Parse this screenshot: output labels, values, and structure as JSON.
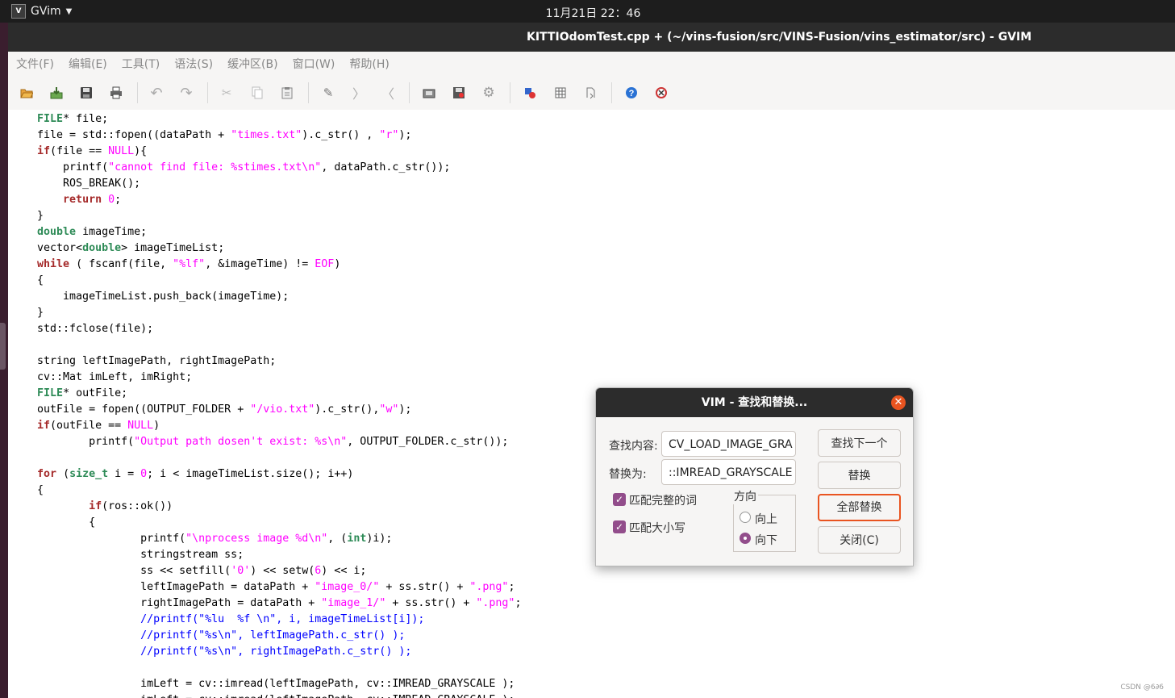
{
  "topbar": {
    "app_name": "GVim",
    "clock": "11月21日  22：46"
  },
  "window": {
    "title": "KITTIOdomTest.cpp + (~/vins-fusion/src/VINS-Fusion/vins_estimator/src) - GVIM"
  },
  "menubar": [
    "文件(F)",
    "编辑(E)",
    "工具(T)",
    "语法(S)",
    "缓冲区(B)",
    "窗口(W)",
    "帮助(H)"
  ],
  "toolbar": [
    {
      "icon": "open-file-icon"
    },
    {
      "icon": "save-download-icon"
    },
    {
      "icon": "save-icon"
    },
    {
      "icon": "print-icon"
    },
    {
      "icon": "undo-icon"
    },
    {
      "icon": "redo-icon"
    },
    {
      "icon": "cut-icon"
    },
    {
      "icon": "copy-icon"
    },
    {
      "icon": "paste-icon"
    },
    {
      "icon": "find-replace-icon"
    },
    {
      "icon": "find-next-icon"
    },
    {
      "icon": "find-prev-icon"
    },
    {
      "icon": "load-session-icon"
    },
    {
      "icon": "save-session-icon"
    },
    {
      "icon": "run-script-icon"
    },
    {
      "icon": "make-icon"
    },
    {
      "icon": "shell-icon"
    },
    {
      "icon": "ctags-icon"
    },
    {
      "icon": "help-icon"
    },
    {
      "icon": "find-help-icon"
    }
  ],
  "editor": {
    "lines": [
      [
        [
          "    ",
          ""
        ],
        [
          "FILE",
          "ty"
        ],
        [
          "* file;",
          ""
        ]
      ],
      [
        [
          "    file = std::fopen((dataPath + ",
          ""
        ],
        [
          "\"times.txt\"",
          "st"
        ],
        [
          ").c_str() , ",
          ""
        ],
        [
          "\"r\"",
          "st"
        ],
        [
          ");",
          ""
        ]
      ],
      [
        [
          "    ",
          ""
        ],
        [
          "if",
          "kw"
        ],
        [
          "(file == ",
          ""
        ],
        [
          "NULL",
          "st"
        ],
        [
          "){",
          ""
        ]
      ],
      [
        [
          "        printf(",
          ""
        ],
        [
          "\"cannot find file: ",
          "st"
        ],
        [
          "%s",
          "st"
        ],
        [
          "times.txt",
          "st"
        ],
        [
          "\\n\"",
          "st"
        ],
        [
          ", dataPath.c_str());",
          ""
        ]
      ],
      [
        [
          "        ROS_BREAK();",
          ""
        ]
      ],
      [
        [
          "        ",
          ""
        ],
        [
          "return",
          "kw"
        ],
        [
          " ",
          ""
        ],
        [
          "0",
          "st"
        ],
        [
          ";",
          ""
        ]
      ],
      [
        [
          "    }",
          ""
        ]
      ],
      [
        [
          "    ",
          ""
        ],
        [
          "double",
          "ty"
        ],
        [
          " imageTime;",
          ""
        ]
      ],
      [
        [
          "    vector<",
          ""
        ],
        [
          "double",
          "ty"
        ],
        [
          "> imageTimeList;",
          ""
        ]
      ],
      [
        [
          "    ",
          ""
        ],
        [
          "while",
          "kw"
        ],
        [
          " ( fscanf(file, ",
          ""
        ],
        [
          "\"%lf\"",
          "st"
        ],
        [
          ", &imageTime) != ",
          ""
        ],
        [
          "EOF",
          "st"
        ],
        [
          ")",
          ""
        ]
      ],
      [
        [
          "    {",
          ""
        ]
      ],
      [
        [
          "        imageTimeList.push_back(imageTime);",
          ""
        ]
      ],
      [
        [
          "    }",
          ""
        ]
      ],
      [
        [
          "    std::fclose(file);",
          ""
        ]
      ],
      [
        [
          "",
          ""
        ]
      ],
      [
        [
          "    string leftImagePath, rightImagePath;",
          ""
        ]
      ],
      [
        [
          "    cv::Mat imLeft, imRight;",
          ""
        ]
      ],
      [
        [
          "    ",
          ""
        ],
        [
          "FILE",
          "ty"
        ],
        [
          "* outFile;",
          ""
        ]
      ],
      [
        [
          "    outFile = fopen((OUTPUT_FOLDER + ",
          ""
        ],
        [
          "\"/vio.txt\"",
          "st"
        ],
        [
          ").c_str(),",
          ""
        ],
        [
          "\"w\"",
          "st"
        ],
        [
          ");",
          ""
        ]
      ],
      [
        [
          "    ",
          ""
        ],
        [
          "if",
          "kw"
        ],
        [
          "(outFile == ",
          ""
        ],
        [
          "NULL",
          "st"
        ],
        [
          ")",
          ""
        ]
      ],
      [
        [
          "            printf(",
          ""
        ],
        [
          "\"Output path dosen't exist: %s\\n\"",
          "st"
        ],
        [
          ", OUTPUT_FOLDER.c_str());",
          ""
        ]
      ],
      [
        [
          "",
          ""
        ]
      ],
      [
        [
          "    ",
          ""
        ],
        [
          "for",
          "kw"
        ],
        [
          " (",
          ""
        ],
        [
          "size_t",
          "ty"
        ],
        [
          " i = ",
          ""
        ],
        [
          "0",
          "st"
        ],
        [
          "; i < imageTimeList.size(); i++)",
          ""
        ]
      ],
      [
        [
          "    {",
          ""
        ]
      ],
      [
        [
          "            ",
          ""
        ],
        [
          "if",
          "kw"
        ],
        [
          "(ros::ok())",
          ""
        ]
      ],
      [
        [
          "            {",
          ""
        ]
      ],
      [
        [
          "                    printf(",
          ""
        ],
        [
          "\"\\nprocess image %d\\n\"",
          "st"
        ],
        [
          ", (",
          ""
        ],
        [
          "int",
          "ty"
        ],
        [
          ")i);",
          ""
        ]
      ],
      [
        [
          "                    stringstream ss;",
          ""
        ]
      ],
      [
        [
          "                    ss << setfill(",
          ""
        ],
        [
          "'0'",
          "st"
        ],
        [
          ") << setw(",
          ""
        ],
        [
          "6",
          "st"
        ],
        [
          ") << i;",
          ""
        ]
      ],
      [
        [
          "                    leftImagePath = dataPath + ",
          ""
        ],
        [
          "\"image_0/\"",
          "st"
        ],
        [
          " + ss.str() + ",
          ""
        ],
        [
          "\".png\"",
          "st"
        ],
        [
          ";",
          ""
        ]
      ],
      [
        [
          "                    rightImagePath = dataPath + ",
          ""
        ],
        [
          "\"image_1/\"",
          "st"
        ],
        [
          " + ss.str() + ",
          ""
        ],
        [
          "\".png\"",
          "st"
        ],
        [
          ";",
          ""
        ]
      ],
      [
        [
          "                    ",
          ""
        ],
        [
          "//printf(\"%lu  %f \\n\", i, imageTimeList[i]);",
          "cm"
        ]
      ],
      [
        [
          "                    ",
          ""
        ],
        [
          "//printf(\"%s\\n\", leftImagePath.c_str() );",
          "cm"
        ]
      ],
      [
        [
          "                    ",
          ""
        ],
        [
          "//printf(\"%s\\n\", rightImagePath.c_str() );",
          "cm"
        ]
      ],
      [
        [
          "",
          ""
        ]
      ],
      [
        [
          "                    imLeft = cv::imread(leftImagePath, cv::IMREAD_GRAYSCALE );",
          ""
        ]
      ],
      [
        [
          "                    imLeft = cv::imread(leftImagePath, cv::IMREAD_GRAYSCALE );",
          ""
        ]
      ]
    ]
  },
  "dialog": {
    "title": "VIM - 查找和替换...",
    "find_label": "查找内容:",
    "find_value": "CV_LOAD_IMAGE_GRA",
    "replace_label": "替换为:",
    "replace_value": "::IMREAD_GRAYSCALE",
    "whole_word_label": "匹配完整的词",
    "whole_word_checked": true,
    "match_case_label": "匹配大小写",
    "match_case_checked": true,
    "direction_label": "方向",
    "up_label": "向上",
    "down_label": "向下",
    "direction_selected": "down",
    "find_next_button": "查找下一个",
    "replace_button": "替换",
    "replace_all_button": "全部替换",
    "close_button": "关闭(C)"
  },
  "watermark": "CSDN @6∂6",
  "colors": {
    "accent": "#e95420",
    "check": "#924d8b",
    "keyword": "#a52a2a",
    "type": "#2e8b57",
    "string": "#ff00ff",
    "comment": "#0000ff"
  }
}
